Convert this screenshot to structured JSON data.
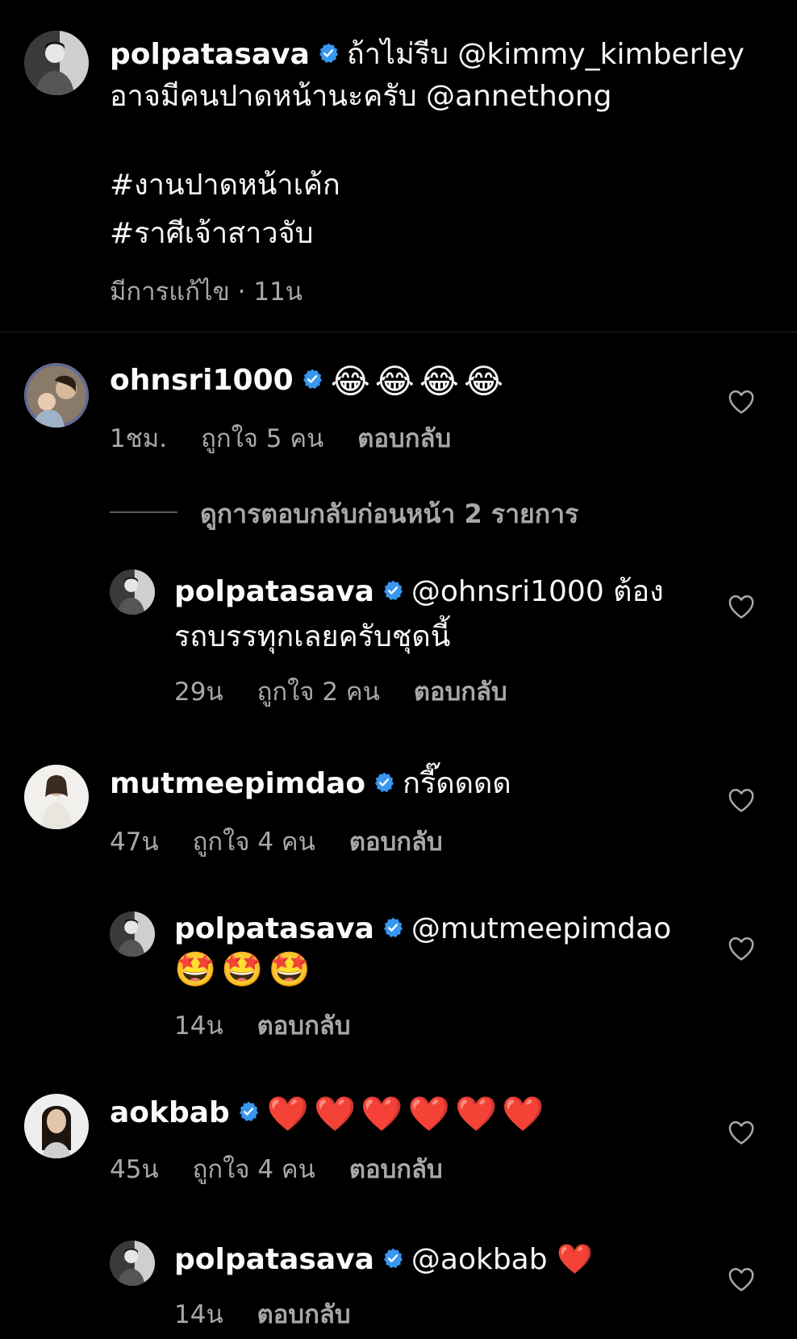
{
  "caption": {
    "username": "polpatasava",
    "text_line1": "ถ้าไม่รีบ @kimmy_kimberley",
    "text_line2": "อาจมีคนปาดหน้านะครับ @annethong",
    "hashtag1": "#งานปาดหน้าเค้ก",
    "hashtag2": "#ราศีเจ้าสาวจับ",
    "meta": "มีการแก้ไข · 11น"
  },
  "comments": [
    {
      "username": "ohnsri1000",
      "text": "😂😂😂😂",
      "time": "1ชม.",
      "likes": "ถูกใจ 5 คน",
      "reply": "ตอบกลับ",
      "view_replies": "ดูการตอบกลับก่อนหน้า 2 รายการ",
      "replies": [
        {
          "username": "polpatasava",
          "text_line1": "@ohnsri1000 ต้อง",
          "text_line2": "รถบรรทุกเลยครับชุดนี้",
          "time": "29น",
          "likes": "ถูกใจ 2 คน",
          "reply": "ตอบกลับ"
        }
      ]
    },
    {
      "username": "mutmeepimdao",
      "text": "กรี๊ดดดด",
      "time": "47น",
      "likes": "ถูกใจ 4 คน",
      "reply": "ตอบกลับ",
      "replies": [
        {
          "username": "polpatasava",
          "text_line1": "@mutmeepimdao",
          "text_line2": "🤩🤩🤩",
          "time": "14น",
          "reply": "ตอบกลับ"
        }
      ]
    },
    {
      "username": "aokbab",
      "text": "❤️❤️❤️❤️❤️❤️",
      "time": "45น",
      "likes": "ถูกใจ 4 คน",
      "reply": "ตอบกลับ",
      "replies": [
        {
          "username": "polpatasava",
          "text_line1": "@aokbab ❤️",
          "time": "14น",
          "reply": "ตอบกลับ"
        }
      ]
    }
  ],
  "colors": {
    "background": "#000000",
    "text": "#f5f5f5",
    "secondary_text": "#a8a8a8",
    "verified": "#3897f0"
  }
}
